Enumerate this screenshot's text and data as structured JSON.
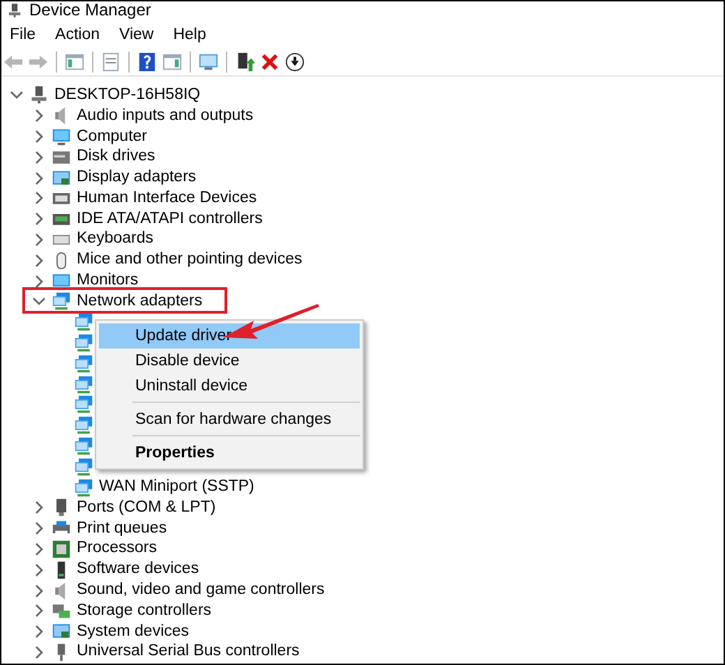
{
  "window": {
    "title": "Device Manager"
  },
  "menu_bar": [
    "File",
    "Action",
    "View",
    "Help"
  ],
  "toolbar": [
    {
      "kind": "back",
      "disabled": true
    },
    {
      "kind": "forward",
      "disabled": true
    },
    {
      "kind": "separator"
    },
    {
      "kind": "tree",
      "disabled": false
    },
    {
      "kind": "separator"
    },
    {
      "kind": "properties",
      "disabled": false
    },
    {
      "kind": "separator"
    },
    {
      "kind": "help",
      "disabled": false
    },
    {
      "kind": "pane",
      "disabled": false
    },
    {
      "kind": "separator"
    },
    {
      "kind": "scan",
      "disabled": false
    },
    {
      "kind": "separator"
    },
    {
      "kind": "update",
      "disabled": false
    },
    {
      "kind": "remove",
      "disabled": false
    },
    {
      "kind": "download",
      "disabled": false
    }
  ],
  "tree": [
    {
      "label": "DESKTOP-16H58IQ",
      "kind": "pc",
      "expanded": true,
      "children": [
        {
          "label": "Audio inputs and outputs",
          "kind": "speaker",
          "expanded": false
        },
        {
          "label": "Computer",
          "kind": "monitor",
          "expanded": false
        },
        {
          "label": "Disk drives",
          "kind": "disk",
          "expanded": false
        },
        {
          "label": "Display adapters",
          "kind": "display",
          "expanded": false
        },
        {
          "label": "Human Interface Devices",
          "kind": "hid",
          "expanded": false
        },
        {
          "label": "IDE ATA/ATAPI controllers",
          "kind": "ide",
          "expanded": false
        },
        {
          "label": "Keyboards",
          "kind": "keyboard",
          "expanded": false
        },
        {
          "label": "Mice and other pointing devices",
          "kind": "mouse",
          "expanded": false
        },
        {
          "label": "Monitors",
          "kind": "monitor",
          "expanded": false
        },
        {
          "label": "Network adapters",
          "kind": "network",
          "expanded": true,
          "children": [
            {
              "kind": "network"
            },
            {
              "kind": "network"
            },
            {
              "kind": "network"
            },
            {
              "kind": "network"
            },
            {
              "kind": "network"
            },
            {
              "kind": "network"
            },
            {
              "kind": "network"
            },
            {
              "kind": "network"
            },
            {
              "label": "WAN Miniport (SSTP)",
              "kind": "network"
            }
          ]
        },
        {
          "label": "Ports (COM & LPT)",
          "kind": "port",
          "expanded": false
        },
        {
          "label": "Print queues",
          "kind": "printer",
          "expanded": false
        },
        {
          "label": "Processors",
          "kind": "chip",
          "expanded": false
        },
        {
          "label": "Software devices",
          "kind": "software",
          "expanded": false
        },
        {
          "label": "Sound, video and game controllers",
          "kind": "speaker",
          "expanded": false
        },
        {
          "label": "Storage controllers",
          "kind": "storage",
          "expanded": false
        },
        {
          "label": "System devices",
          "kind": "display",
          "expanded": false
        },
        {
          "label": "Universal Serial Bus controllers",
          "kind": "usb",
          "expanded": false
        }
      ]
    }
  ],
  "context_menu": [
    {
      "kind": "item",
      "label": "Update driver",
      "selected": true,
      "default": false
    },
    {
      "kind": "item",
      "label": "Disable device",
      "selected": false,
      "default": false
    },
    {
      "kind": "item",
      "label": "Uninstall device",
      "selected": false,
      "default": false
    },
    {
      "kind": "separator"
    },
    {
      "kind": "item",
      "label": "Scan for hardware changes",
      "selected": false,
      "default": false
    },
    {
      "kind": "separator"
    },
    {
      "kind": "item",
      "label": "Properties",
      "selected": false,
      "default": true
    }
  ]
}
